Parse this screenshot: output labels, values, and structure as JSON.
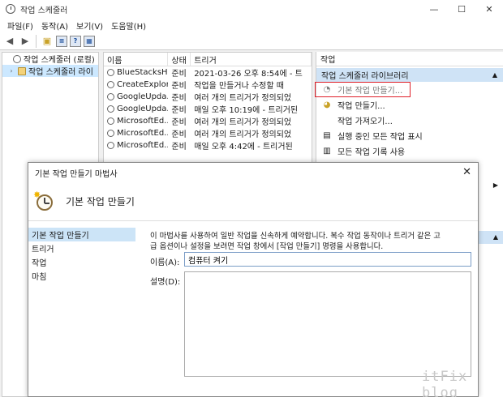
{
  "window": {
    "title": "작업 스케줄러",
    "minimize": "—",
    "maximize": "☐",
    "close": "✕"
  },
  "menu": [
    "파일(F)",
    "동작(A)",
    "보기(V)",
    "도움말(H)"
  ],
  "toolbar": {
    "icons": [
      "back-arrow-icon",
      "forward-arrow-icon",
      "folder-up-icon",
      "properties-icon",
      "help-icon",
      "console-icon"
    ]
  },
  "tree": {
    "items": [
      {
        "label": "작업 스케줄러 (로컬)",
        "expander": ""
      },
      {
        "label": "작업 스케줄러 라이",
        "expander": "›"
      }
    ]
  },
  "list": {
    "columns": [
      "이름",
      "상태",
      "트리거"
    ],
    "rows": [
      {
        "name": "BlueStacksH...",
        "status": "준비",
        "trigger": "2021-03-26 오후 8:54에 - 트"
      },
      {
        "name": "CreateExplor...",
        "status": "준비",
        "trigger": "작업을 만들거나 수정할 때"
      },
      {
        "name": "GoogleUpda...",
        "status": "준비",
        "trigger": "여러 개의 트리거가 정의되었"
      },
      {
        "name": "GoogleUpda...",
        "status": "준비",
        "trigger": "매일 오후 10:19에 - 트리거된"
      },
      {
        "name": "MicrosoftEd...",
        "status": "준비",
        "trigger": "여러 개의 트리거가 정의되었"
      },
      {
        "name": "MicrosoftEd...",
        "status": "준비",
        "trigger": "여러 개의 트리거가 정의되었"
      },
      {
        "name": "MicrosoftEd...",
        "status": "준비",
        "trigger": "매일 오후 4:42에 - 트리거된"
      }
    ]
  },
  "actions": {
    "title": "작업",
    "section": "작업 스케줄러 라이브러리",
    "items": [
      {
        "label": "기본 작업 만들기...",
        "icon": "basic-task-icon",
        "highlighted": true
      },
      {
        "label": "작업 만들기...",
        "icon": "create-task-icon",
        "highlighted": false
      },
      {
        "label": "작업 가져오기...",
        "icon": "import-icon",
        "highlighted": false
      },
      {
        "label": "실행 중인 모든 작업 표시",
        "icon": "running-tasks-icon",
        "highlighted": false
      },
      {
        "label": "모든 작업 기록 사용",
        "icon": "history-icon",
        "highlighted": false
      }
    ],
    "expand_arrow": "▶",
    "collapse_arrow": "▲"
  },
  "dialog": {
    "title": "기본 작업 만들기 마법사",
    "close": "✕",
    "heading": "기본 작업 만들기",
    "nav": [
      "기본 작업 만들기",
      "트리거",
      "작업",
      "마침"
    ],
    "description_line1": "이 마법사를 사용하여 일반 작업을 신속하게 예약합니다. 복수 작업 동작이나 트리거 같은 고",
    "description_line2": "급 옵션이나 설정을 보려면 작업 창에서 [작업 만들기] 명령을 사용합니다.",
    "name_label": "이름(A):",
    "name_value": "컴퓨터 켜기",
    "desc_label": "설명(D):",
    "desc_value": ""
  },
  "watermark": "itFix blog"
}
